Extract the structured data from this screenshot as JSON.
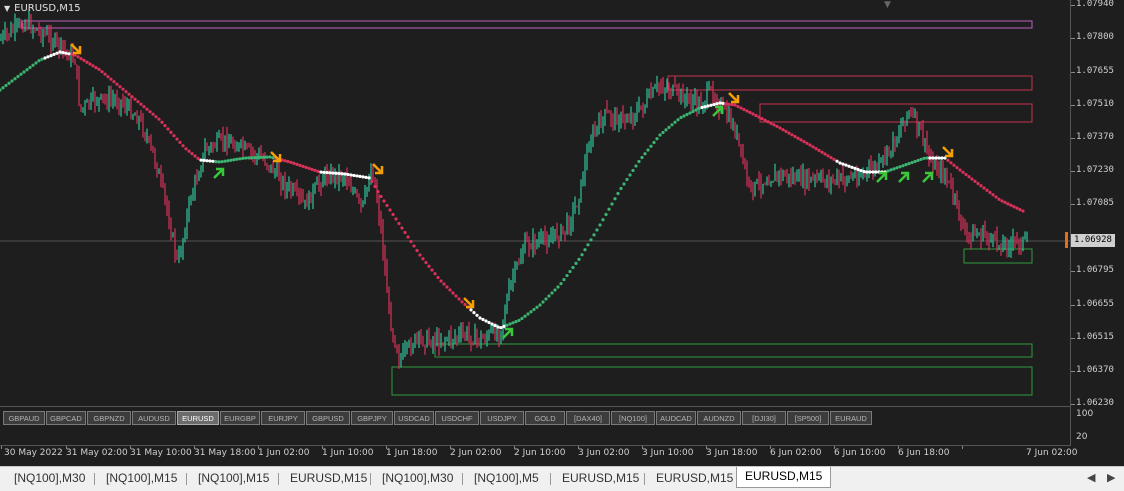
{
  "chart_title": "EURUSD,M15",
  "current_price": "1.06928",
  "price_axis": [
    "1.07940",
    "1.07800",
    "1.07655",
    "1.07510",
    "1.07370",
    "1.07230",
    "1.07085",
    "1.06795",
    "1.06655",
    "1.06515",
    "1.06370",
    "1.06230"
  ],
  "indicator_axis": [
    "100",
    "20"
  ],
  "time_axis": [
    "30 May 2022",
    "31 May 02:00",
    "31 May 10:00",
    "31 May 18:00",
    "1 Jun 02:00",
    "1 Jun 10:00",
    "1 Jun 18:00",
    "2 Jun 02:00",
    "2 Jun 10:00",
    "3 Jun 02:00",
    "3 Jun 10:00",
    "3 Jun 18:00",
    "6 Jun 02:00",
    "6 Jun 10:00",
    "6 Jun 18:00",
    "7 Jun 02:00"
  ],
  "symbol_buttons": [
    "GBPAUD",
    "GBPCAD",
    "GBPNZD",
    "AUDUSD",
    "EURUSD",
    "EURGBP",
    "EURJPY",
    "GBPUSD",
    "GBPJPY",
    "USDCAD",
    "USDCHF",
    "USDJPY",
    "GOLD",
    "[DAX40]",
    "[NQ100]",
    "AUDCAD",
    "AUDNZD",
    "[DJI30]",
    "[SP500]",
    "EURAUD"
  ],
  "active_symbol": "EURUSD",
  "tabs": [
    "[NQ100],M30",
    "[NQ100],M15",
    "[NQ100],M15",
    "EURUSD,M15",
    "[NQ100],M30",
    "[NQ100],M5",
    "EURUSD,M15",
    "EURUSD,M15",
    "EURUSD,M15"
  ],
  "active_tab_index": 8,
  "colors": {
    "bull": "#2fc39a",
    "bear": "#d9315a",
    "ma_up": "#3cb371",
    "ma_down": "#d9315a",
    "ma_flat": "#ffffff",
    "signal_buy": "#3ac73a",
    "signal_sell": "#f5a000",
    "zone_supply": "#c8324f",
    "zone_demand": "#2e9a3e",
    "zone_top": "#c060c0"
  },
  "icons": {
    "scroll_left": "triangle-left-icon",
    "scroll_right": "triangle-right-icon",
    "menu": "triangle-down-icon"
  }
}
